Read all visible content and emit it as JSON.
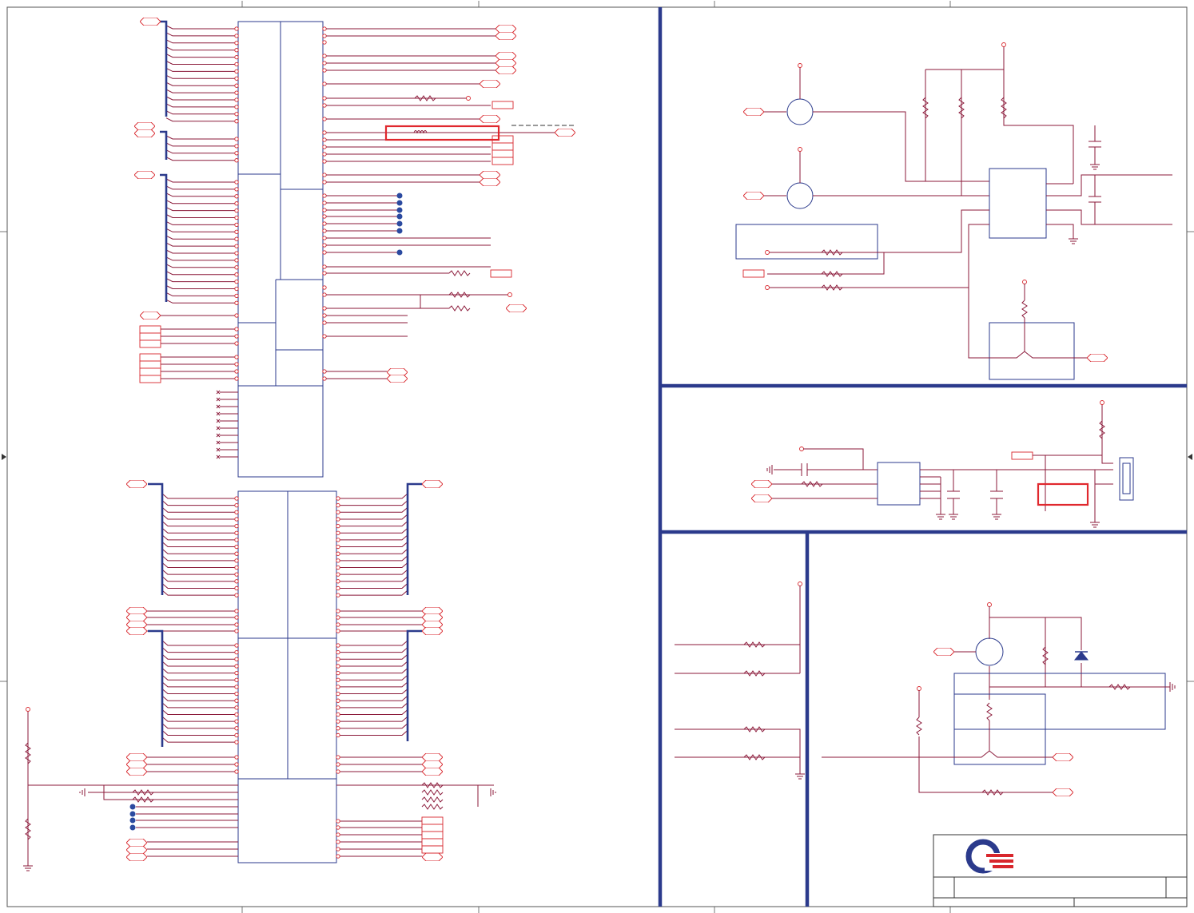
{
  "sheet": {
    "description": "schematic",
    "colors": {
      "wire": "#8b1a3a",
      "pin": "#d8262c",
      "block": "#2b3a8c",
      "highlight": "#e0282e",
      "logo_blue": "#2b3a8c",
      "logo_red": "#d8262c"
    }
  },
  "title_block": {
    "logo": "company-logo"
  }
}
